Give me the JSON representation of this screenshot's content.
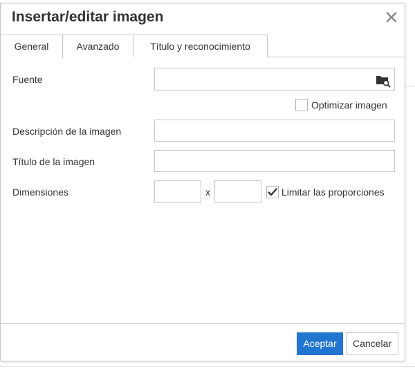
{
  "dialog": {
    "title": "Insertar/editar imagen",
    "close_icon": "close-icon"
  },
  "tabs": [
    {
      "label": "General",
      "active": true
    },
    {
      "label": "Avanzado",
      "active": false
    },
    {
      "label": "Título y reconocimiento",
      "active": false
    }
  ],
  "form": {
    "source_label": "Fuente",
    "source_value": "",
    "browse_icon": "folder-search-icon",
    "optimize_label": "Optimizar imagen",
    "optimize_checked": false,
    "description_label": "Descripción de la imagen",
    "description_value": "",
    "title_label": "Título de la imagen",
    "title_value": "",
    "dimensions_label": "Dimensiones",
    "width_value": "",
    "height_value": "",
    "dimension_separator": "x",
    "constrain_label": "Limitar las proporciones",
    "constrain_checked": true
  },
  "footer": {
    "ok_label": "Aceptar",
    "cancel_label": "Cancelar"
  },
  "colors": {
    "primary": "#2276d2",
    "border": "#c5c5c5",
    "text": "#333333"
  }
}
